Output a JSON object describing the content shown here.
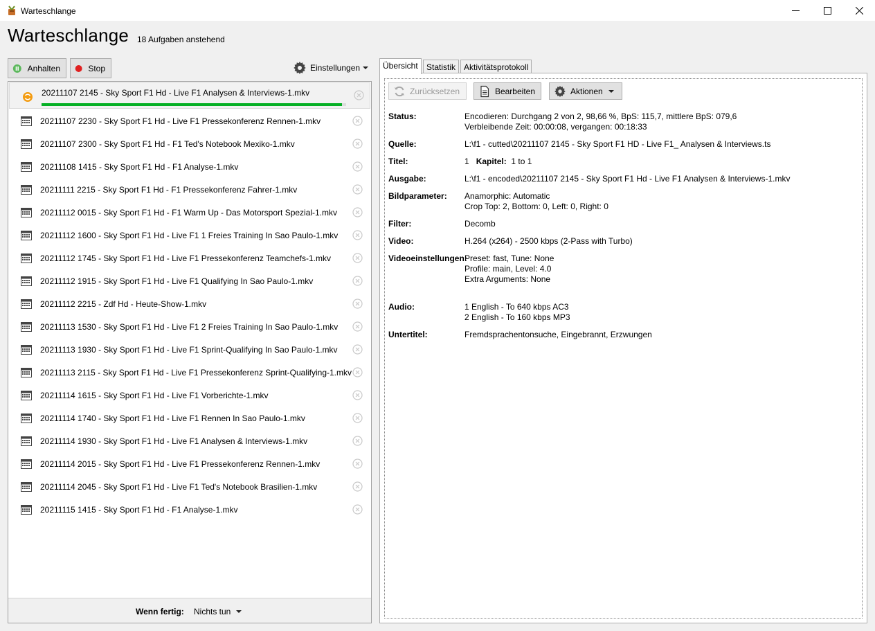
{
  "window": {
    "title": "Warteschlange"
  },
  "header": {
    "heading": "Warteschlange",
    "pending": "18 Aufgaben anstehend"
  },
  "toolbar": {
    "pause_label": "Anhalten",
    "stop_label": "Stop",
    "settings_label": "Einstellungen"
  },
  "queue": {
    "items": [
      {
        "name": "20211107 2145 - Sky Sport F1 Hd - Live F1  Analysen & Interviews-1.mkv",
        "status": "encoding",
        "progress": 0.9866
      },
      {
        "name": "20211107 2230 - Sky Sport F1 Hd - Live F1  Pressekonferenz Rennen-1.mkv",
        "status": "waiting"
      },
      {
        "name": "20211107 2300 - Sky Sport F1 Hd - F1  Ted's Notebook  Mexiko-1.mkv",
        "status": "waiting"
      },
      {
        "name": "20211108 1415 - Sky Sport F1 Hd - F1  Analyse-1.mkv",
        "status": "waiting"
      },
      {
        "name": "20211111 2215 - Sky Sport F1 Hd - F1  Pressekonferenz Fahrer-1.mkv",
        "status": "waiting"
      },
      {
        "name": "20211112 0015 - Sky Sport F1 Hd - F1  Warm Up - Das Motorsport Spezial-1.mkv",
        "status": "waiting"
      },
      {
        "name": "20211112 1600 - Sky Sport F1 Hd - Live F1  1  Freies Training In Sao Paulo-1.mkv",
        "status": "waiting"
      },
      {
        "name": "20211112 1745 - Sky Sport F1 Hd - Live F1  Pressekonferenz Teamchefs-1.mkv",
        "status": "waiting"
      },
      {
        "name": "20211112 1915 - Sky Sport F1 Hd - Live F1  Qualifying In Sao Paulo-1.mkv",
        "status": "waiting"
      },
      {
        "name": "20211112 2215 - Zdf Hd - Heute-Show-1.mkv",
        "status": "waiting"
      },
      {
        "name": "20211113 1530 - Sky Sport F1 Hd - Live F1  2  Freies Training In Sao Paulo-1.mkv",
        "status": "waiting"
      },
      {
        "name": "20211113 1930 - Sky Sport F1 Hd - Live F1  Sprint-Qualifying In Sao Paulo-1.mkv",
        "status": "waiting"
      },
      {
        "name": "20211113 2115 - Sky Sport F1 Hd - Live F1  Pressekonferenz Sprint-Qualifying-1.mkv",
        "status": "waiting"
      },
      {
        "name": "20211114 1615 - Sky Sport F1 Hd - Live F1  Vorberichte-1.mkv",
        "status": "waiting"
      },
      {
        "name": "20211114 1740 - Sky Sport F1 Hd - Live F1  Rennen In Sao Paulo-1.mkv",
        "status": "waiting"
      },
      {
        "name": "20211114 1930 - Sky Sport F1 Hd - Live F1  Analysen & Interviews-1.mkv",
        "status": "waiting"
      },
      {
        "name": "20211114 2015 - Sky Sport F1 Hd - Live F1  Pressekonferenz Rennen-1.mkv",
        "status": "waiting"
      },
      {
        "name": "20211114 2045 - Sky Sport F1 Hd - Live F1  Ted's Notebook  Brasilien-1.mkv",
        "status": "waiting"
      },
      {
        "name": "20211115 1415 - Sky Sport F1 Hd - F1  Analyse-1.mkv",
        "status": "waiting"
      }
    ],
    "when_done_label": "Wenn fertig:",
    "when_done_value": "Nichts tun"
  },
  "tabs": [
    "Übersicht",
    "Statistik",
    "Aktivitätsprotokoll"
  ],
  "detail": {
    "actions": {
      "reset_label": "Zurücksetzen",
      "edit_label": "Bearbeiten",
      "actions_label": "Aktionen"
    },
    "status_label": "Status:",
    "status_line1": "Encodieren: Durchgang 2 von 2, 98,66 %, BpS: 115,7, mittlere BpS: 079,6",
    "status_line2": "Verbleibende Zeit: 00:00:08, vergangen: 00:18:33",
    "source_label": "Quelle:",
    "source_value": "L:\\f1 - cutted\\20211107 2145 - Sky Sport F1 HD - Live F1_ Analysen & Interviews.ts",
    "title_label": "Titel:",
    "title_value": "1",
    "chapter_label": "Kapitel:",
    "chapter_value": "1  to  1",
    "output_label": "Ausgabe:",
    "output_value": "L:\\f1 - encoded\\20211107 2145 - Sky Sport F1 Hd - Live F1  Analysen & Interviews-1.mkv",
    "picture_label": "Bildparameter:",
    "picture_line1": "Anamorphic: Automatic",
    "picture_line2": "Crop Top: 2, Bottom: 0, Left: 0, Right: 0",
    "filter_label": "Filter:",
    "filter_value": "Decomb",
    "video_label": "Video:",
    "video_value": "H.264 (x264) - 2500  kbps (2-Pass with Turbo)",
    "video_settings_label": "Videoeinstellungen:",
    "video_settings_line1": "Preset: fast, Tune: None",
    "video_settings_line2": "Profile: main, Level: 4.0",
    "video_settings_line3": "Extra Arguments: None",
    "audio_label": "Audio:",
    "audio_line1": "1 English -   To 640 kbps AC3",
    "audio_line2": "2 English -   To 160 kbps MP3",
    "subtitle_label": "Untertitel:",
    "subtitle_value": "Fremdsprachentonsuche, Eingebrannt, Erzwungen"
  }
}
